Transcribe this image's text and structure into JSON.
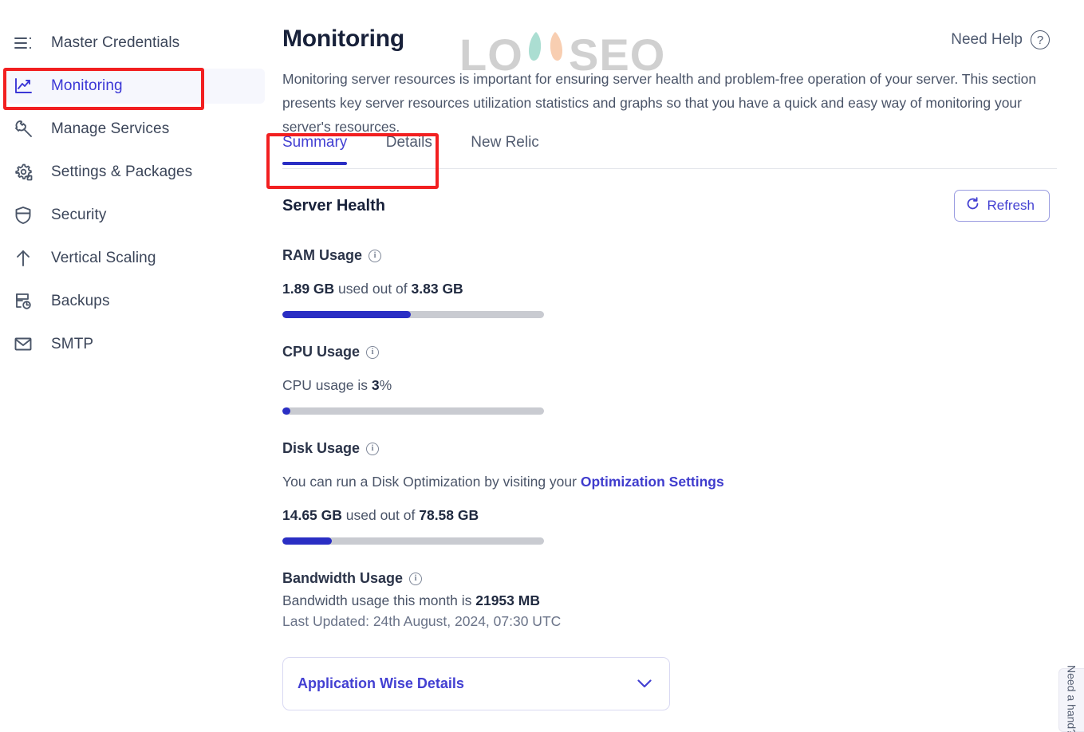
{
  "sidebar": {
    "items": [
      {
        "label": "Master Credentials",
        "icon": "menu-list-icon",
        "active": false
      },
      {
        "label": "Monitoring",
        "icon": "line-chart-icon",
        "active": true
      },
      {
        "label": "Manage Services",
        "icon": "wrench-icon",
        "active": false
      },
      {
        "label": "Settings & Packages",
        "icon": "gear-icon",
        "active": false
      },
      {
        "label": "Security",
        "icon": "shield-icon",
        "active": false
      },
      {
        "label": "Vertical Scaling",
        "icon": "arrow-up-icon",
        "active": false
      },
      {
        "label": "Backups",
        "icon": "backup-restore-icon",
        "active": false
      },
      {
        "label": "SMTP",
        "icon": "envelope-icon",
        "active": false
      }
    ]
  },
  "header": {
    "title": "Monitoring",
    "description": "Monitoring server resources is important for ensuring server health and problem-free operation of your server. This section presents key server resources utilization statistics and graphs so that you have a quick and easy way of monitoring your server's resources.",
    "need_help_label": "Need Help",
    "need_help_icon": "question-circle-icon",
    "watermark_text": "LOYSEO"
  },
  "tabs": [
    {
      "label": "Summary",
      "active": true
    },
    {
      "label": "Details",
      "active": false
    },
    {
      "label": "New Relic",
      "active": false
    }
  ],
  "content": {
    "section_title": "Server Health",
    "refresh_label": "Refresh",
    "refresh_icon": "refresh-icon",
    "ram": {
      "label": "RAM Usage",
      "info_icon": "info-icon",
      "used": "1.89 GB",
      "mid_text": " used out of ",
      "total": "3.83 GB",
      "percent": 49
    },
    "cpu": {
      "label": "CPU Usage",
      "info_icon": "info-icon",
      "prefix": "CPU usage is ",
      "value": "3",
      "suffix": "%",
      "percent": 3
    },
    "disk": {
      "label": "Disk Usage",
      "info_icon": "info-icon",
      "hint_prefix": "You can run a Disk Optimization by visiting your ",
      "hint_link": "Optimization Settings",
      "used": "14.65 GB",
      "mid_text": " used out of ",
      "total": "78.58 GB",
      "percent": 19
    },
    "bandwidth": {
      "label": "Bandwidth Usage",
      "info_icon": "info-icon",
      "prefix": "Bandwidth usage this month is ",
      "value": "21953 MB",
      "last_updated": "Last Updated: 24th August, 2024, 07:30 UTC"
    },
    "app_details": {
      "label": "Application Wise Details",
      "chevron_icon": "chevron-down-icon"
    }
  },
  "help_tab": {
    "label": "Need a hand?"
  },
  "colors": {
    "accent": "#2a2ec4",
    "accent_text": "#4340d2",
    "annotation": "#f21f20",
    "track": "#c9cbd1",
    "text": "#4a5468",
    "heading": "#18213a"
  }
}
